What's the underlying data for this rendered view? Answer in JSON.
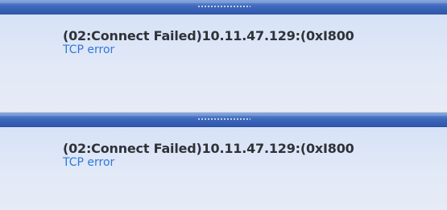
{
  "notifications": [
    {
      "title": "(02:Connect Failed)10.11.47.129:(0xI800",
      "subtitle": "TCP error"
    },
    {
      "title": "(02:Connect Failed)10.11.47.129:(0xI800",
      "subtitle": "TCP error"
    }
  ],
  "colors": {
    "title_bar": "#3f69bd",
    "panel_background": "#dfe6f0",
    "title_text": "#2f3338",
    "subtitle_text": "#2f78d8"
  },
  "icons": {
    "drag_handle": "grip-dots-icon"
  }
}
